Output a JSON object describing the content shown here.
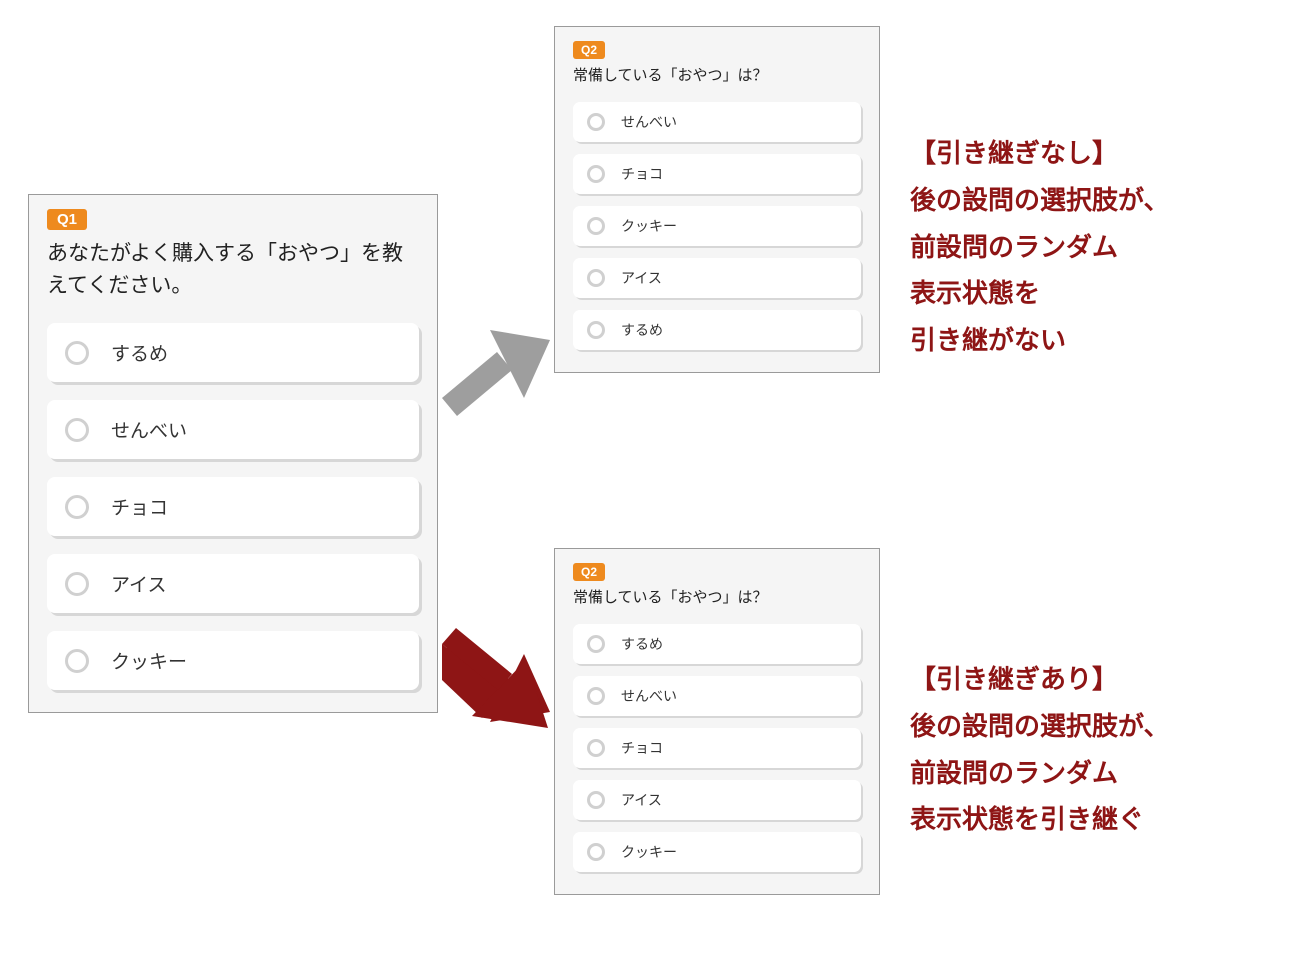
{
  "colors": {
    "accent_orange": "#EE8A1E",
    "accent_red": "#8E1515",
    "arrow_gray": "#9E9E9E"
  },
  "q1": {
    "tag": "Q1",
    "text": "あなたがよく購入する「おやつ」を教えてください。",
    "options": [
      "するめ",
      "せんべい",
      "チョコ",
      "アイス",
      "クッキー"
    ]
  },
  "q2_no_inherit": {
    "tag": "Q2",
    "text": "常備している「おやつ」は？",
    "options": [
      "せんべい",
      "チョコ",
      "クッキー",
      "アイス",
      "するめ"
    ]
  },
  "q2_inherit": {
    "tag": "Q2",
    "text": "常備している「おやつ」は？",
    "options": [
      "するめ",
      "せんべい",
      "チョコ",
      "アイス",
      "クッキー"
    ]
  },
  "caption_no": {
    "title": "【引き継ぎなし】",
    "line1": "後の設問の選択肢が、",
    "line2": "前設問のランダム",
    "line3": "表示状態を",
    "line4": "引き継がない"
  },
  "caption_yes": {
    "title": "【引き継ぎあり】",
    "line1": "後の設問の選択肢が、",
    "line2": "前設問のランダム",
    "line3": "表示状態を引き継ぐ"
  }
}
